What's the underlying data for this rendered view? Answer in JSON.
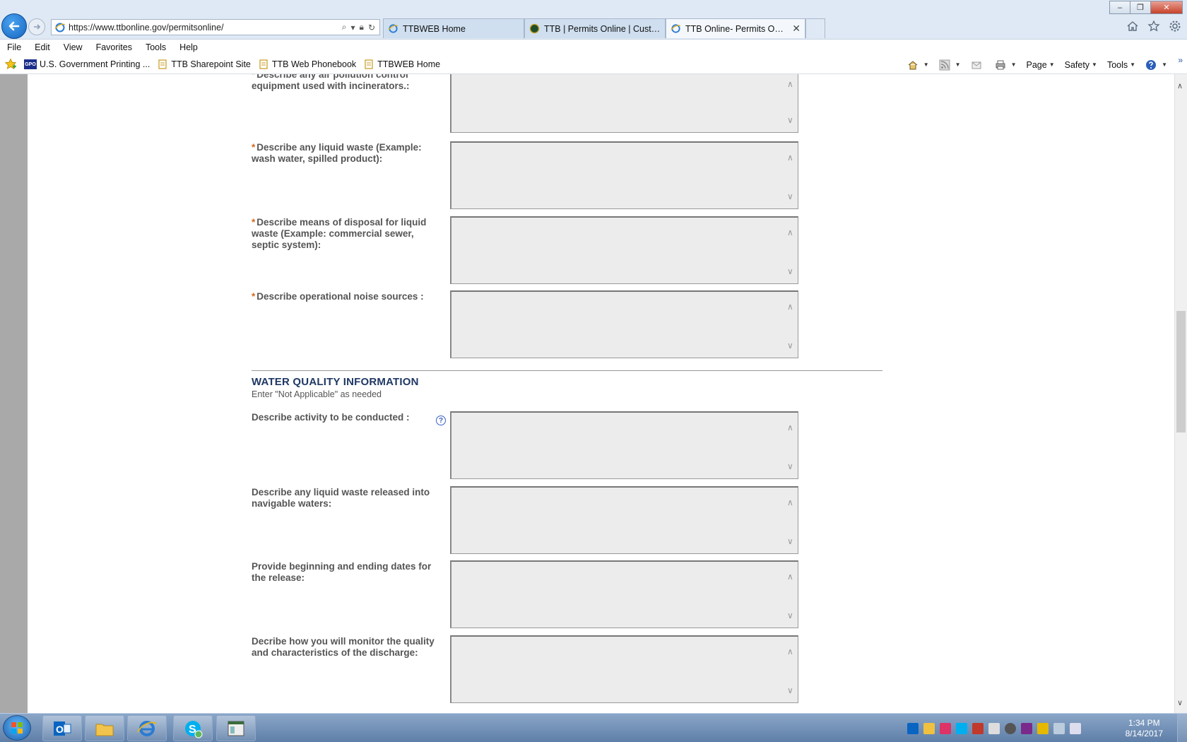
{
  "browser": {
    "url": "https://www.ttbonline.gov/permitsonline/",
    "tabs": [
      {
        "label": "TTBWEB Home",
        "active": false
      },
      {
        "label": "TTB | Permits Online | Custom...",
        "active": false
      },
      {
        "label": "TTB Online- Permits Online...",
        "active": true
      }
    ],
    "menu": [
      "File",
      "Edit",
      "View",
      "Favorites",
      "Tools",
      "Help"
    ],
    "favorites": [
      {
        "label": "U.S. Government Printing ...",
        "icon": "gpo-icon",
        "badge": "GPO"
      },
      {
        "label": "TTB Sharepoint Site",
        "icon": "page-icon"
      },
      {
        "label": "TTB Web Phonebook",
        "icon": "page-icon"
      },
      {
        "label": "TTBWEB Home",
        "icon": "page-icon"
      }
    ],
    "commands": [
      "Page",
      "Safety",
      "Tools"
    ]
  },
  "form": {
    "fields_air": [
      {
        "label": "Describe any air pollution control equipment used with incinerators.:",
        "required": true
      },
      {
        "label": "Describe any liquid waste (Example: wash water, spilled product):",
        "required": true
      },
      {
        "label": "Describe means of disposal for liquid waste (Example: commercial sewer, septic system):",
        "required": true
      },
      {
        "label": "Describe operational noise sources :",
        "required": true
      }
    ],
    "water_section": {
      "title": "WATER QUALITY INFORMATION",
      "note": "Enter \"Not Applicable\" as needed"
    },
    "fields_water": [
      {
        "label": "Describe activity to be conducted :",
        "required": false,
        "help": true
      },
      {
        "label": "Describe any liquid waste released into navigable waters:",
        "required": false
      },
      {
        "label": "Provide beginning and ending dates for the release:",
        "required": false
      },
      {
        "label": "Decribe how you will monitor the quality and characteristics of the discharge:",
        "required": false
      }
    ],
    "required_mark": "*",
    "help_mark": "?"
  },
  "taskbar": {
    "time": "1:34 PM",
    "date": "8/14/2017"
  }
}
